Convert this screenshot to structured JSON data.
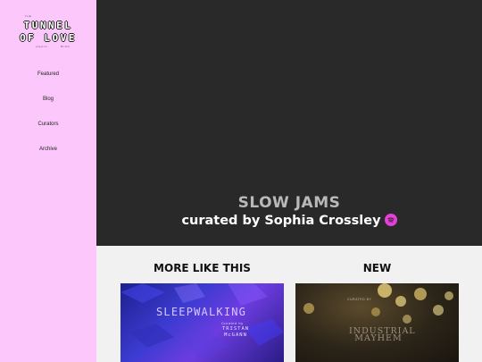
{
  "logo": {
    "top_small": "THE",
    "line1": "TUNNEL",
    "line2": "OF LOVE",
    "bottom_small_left": "playlist",
    "bottom_small_right": "BLOG"
  },
  "nav": {
    "items": [
      {
        "label": "Featured"
      },
      {
        "label": "Blog"
      },
      {
        "label": "Curators"
      },
      {
        "label": "Archive"
      }
    ]
  },
  "hero": {
    "title": "SLOW JAMS",
    "subtitle": "curated by Sophia Crossley",
    "icon": "spotify-icon",
    "background": "#2a292a"
  },
  "sections": {
    "more_like_this": "MORE LIKE THIS",
    "new": "NEW"
  },
  "cards": [
    {
      "title": "SLEEPWALKING",
      "curated_label": "Curated by",
      "curator": "TRISTAN McGANN"
    },
    {
      "title": "INDUSTRIAL MAYHEM",
      "curated_label": "CURATED BY"
    }
  ],
  "colors": {
    "sidebar": "#fcc8fb",
    "accent": "#e53fd8",
    "page_bg": "#f1f1f1"
  }
}
